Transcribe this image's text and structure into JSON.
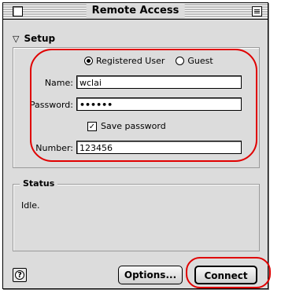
{
  "window": {
    "title": "Remote Access"
  },
  "setup": {
    "header": "Setup",
    "mode_options": [
      "Registered User",
      "Guest"
    ],
    "selected_mode": "Registered User",
    "name_label": "Name:",
    "name_value": "wclai",
    "password_label": "Password:",
    "password_value": "••••••",
    "save_password_label": "Save password",
    "save_password_checked": true,
    "number_label": "Number:",
    "number_value": "123456"
  },
  "status": {
    "title": "Status",
    "text": "Idle."
  },
  "buttons": {
    "options_label": "Options...",
    "connect_label": "Connect"
  },
  "icons": {
    "help": "help-icon",
    "disclosure": "disclosure-triangle-icon"
  },
  "colors": {
    "annotation": "#e00000"
  }
}
